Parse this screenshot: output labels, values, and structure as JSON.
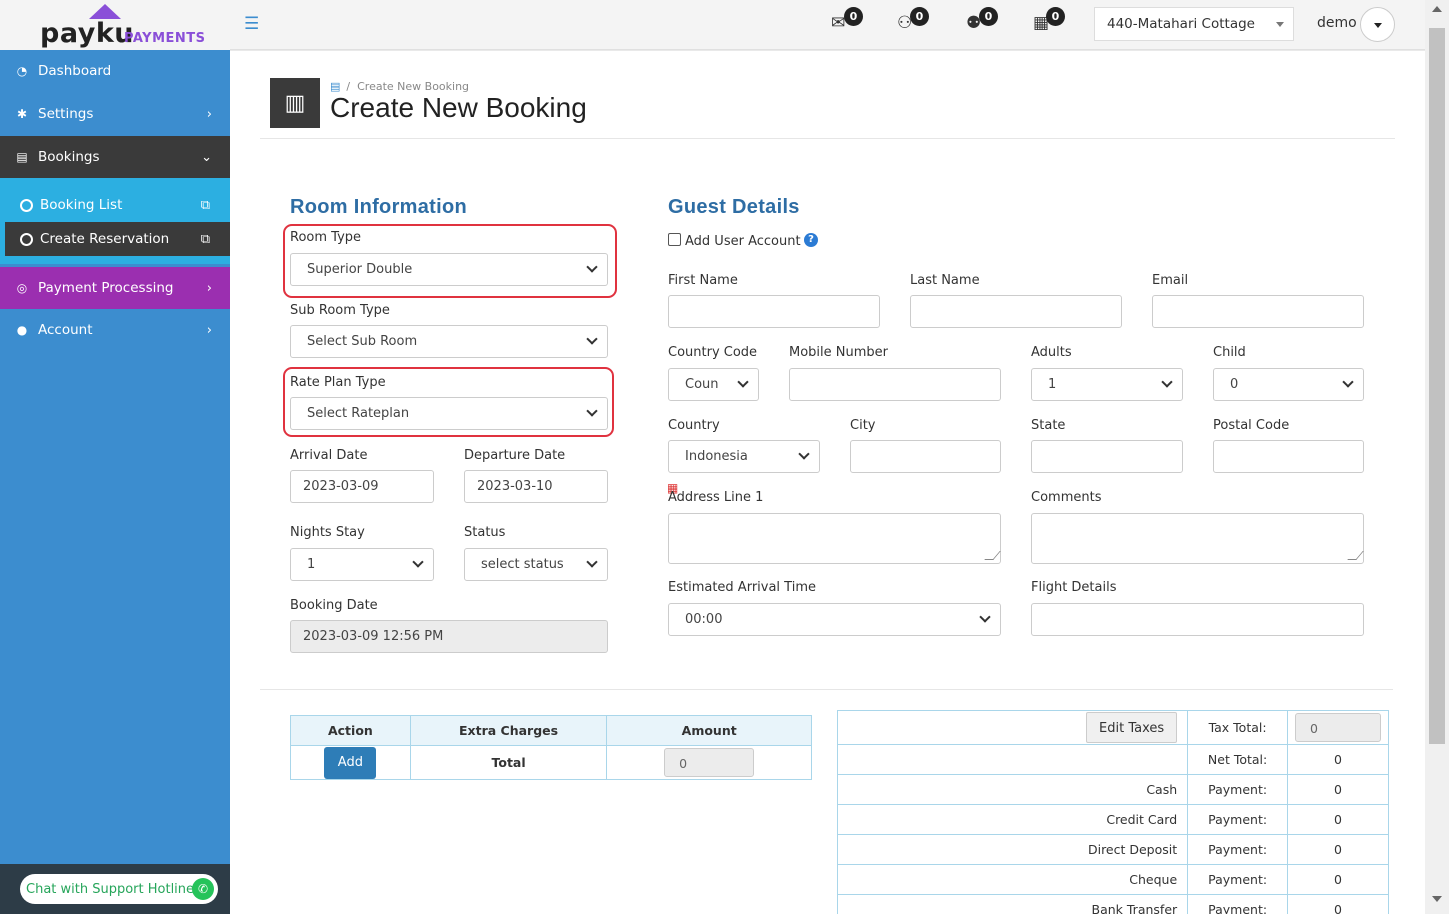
{
  "logo": {
    "brand": "payku",
    "sub": "PAYMENTS"
  },
  "sidebar": {
    "items": [
      {
        "label": "Dashboard",
        "icon": "dashboard-icon"
      },
      {
        "label": "Settings",
        "icon": "gear-icon"
      },
      {
        "label": "Bookings",
        "icon": "bookings-icon"
      },
      {
        "label": "Payment Processing",
        "icon": "payment-icon"
      },
      {
        "label": "Account",
        "icon": "user-icon"
      }
    ],
    "sub_items": [
      {
        "label": "Booking List"
      },
      {
        "label": "Create Reservation"
      }
    ],
    "support": "Chat with Support Hotline"
  },
  "topbar": {
    "badges": [
      "0",
      "0",
      "0",
      "0"
    ],
    "property": "440-Matahari Cottage",
    "user": "demo"
  },
  "header": {
    "breadcrumb": "Create New Booking",
    "title": "Create New Booking"
  },
  "room": {
    "section_title": "Room Information",
    "room_type_label": "Room Type",
    "room_type_value": "Superior Double",
    "sub_room_label": "Sub Room Type",
    "sub_room_value": "Select Sub Room",
    "rate_plan_label": "Rate Plan Type",
    "rate_plan_value": "Select Rateplan",
    "arrival_label": "Arrival Date",
    "arrival_value": "2023-03-09",
    "departure_label": "Departure Date",
    "departure_value": "2023-03-10",
    "nights_label": "Nights Stay",
    "nights_value": "1",
    "status_label": "Status",
    "status_value": "select status",
    "booking_date_label": "Booking Date",
    "booking_date_value": "2023-03-09 12:56 PM"
  },
  "guest": {
    "section_title": "Guest Details",
    "add_user_label": "Add User Account",
    "first_name_label": "First Name",
    "last_name_label": "Last Name",
    "email_label": "Email",
    "country_code_label": "Country Code",
    "country_code_value": "Coun",
    "mobile_label": "Mobile Number",
    "adults_label": "Adults",
    "adults_value": "1",
    "child_label": "Child",
    "child_value": "0",
    "country_label": "Country",
    "country_value": "Indonesia",
    "city_label": "City",
    "state_label": "State",
    "postal_label": "Postal Code",
    "address_label": "Address Line 1",
    "comments_label": "Comments",
    "eta_label": "Estimated Arrival Time",
    "eta_value": "00:00",
    "flight_label": "Flight Details"
  },
  "charges": {
    "headers": [
      "Action",
      "Extra Charges",
      "Amount"
    ],
    "add_label": "Add",
    "total_label": "Total",
    "amount_value": "0"
  },
  "totals": {
    "edit_taxes": "Edit Taxes",
    "tax_total_label": "Tax Total:",
    "tax_total_value": "0",
    "net_total_label": "Net Total:",
    "net_total_value": "0",
    "payments": [
      {
        "method": "Cash",
        "label": "Payment:",
        "value": "0"
      },
      {
        "method": "Credit Card",
        "label": "Payment:",
        "value": "0"
      },
      {
        "method": "Direct Deposit",
        "label": "Payment:",
        "value": "0"
      },
      {
        "method": "Cheque",
        "label": "Payment:",
        "value": "0"
      },
      {
        "method": "Bank Transfer",
        "label": "Payment:",
        "value": "0"
      }
    ]
  },
  "colors": {
    "sidebar": "#3c8dcf",
    "active_nav": "#3a3a3a",
    "payment_nav": "#9b2fb0",
    "sub_nav": "#2cafe1",
    "section_title": "#2e6da4",
    "highlight": "#e0323f"
  }
}
